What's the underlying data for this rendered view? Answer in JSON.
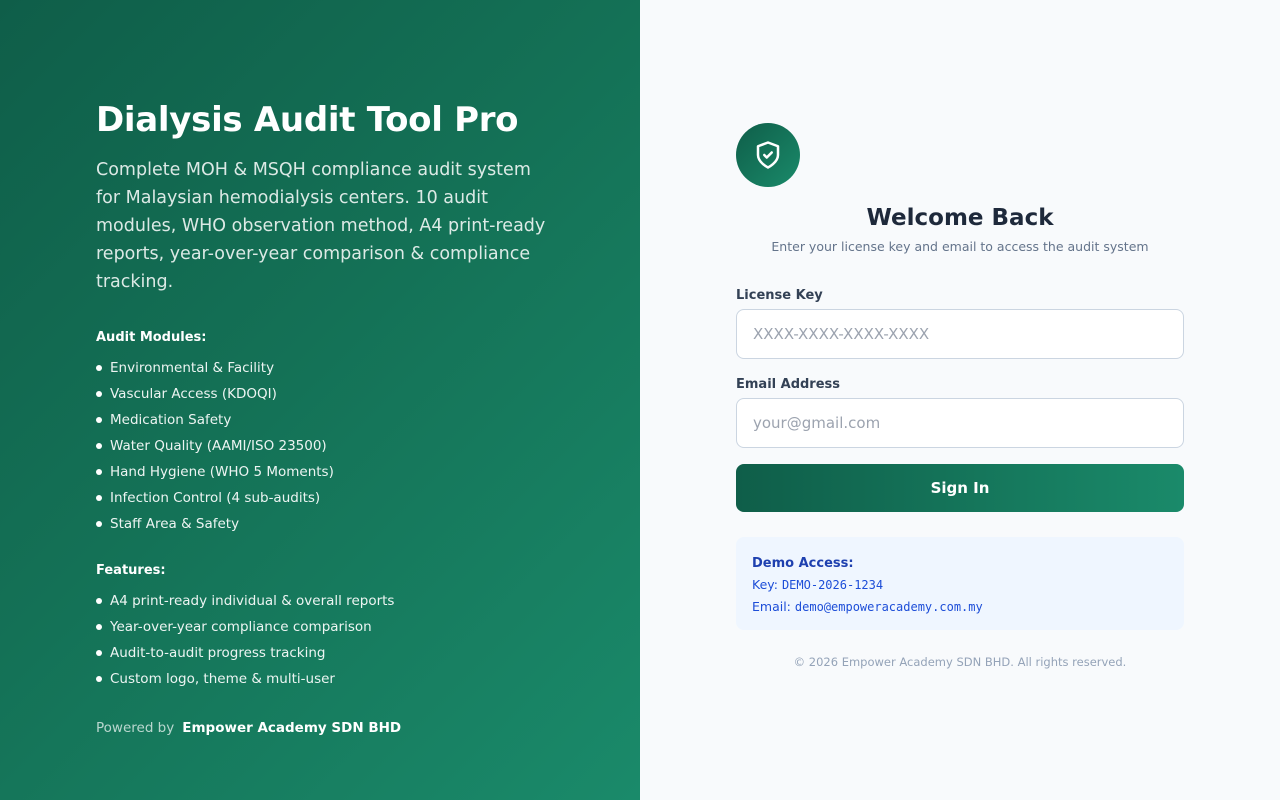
{
  "brand": {
    "title": "Dialysis Audit Tool Pro",
    "description": "Complete MOH & MSQH compliance audit system for Malaysian hemodialysis centers. 10 audit modules, WHO observation method, A4 print-ready reports, year-over-year comparison & compliance tracking."
  },
  "modules": {
    "title": "Audit Modules:",
    "items": [
      "Environmental & Facility",
      "Vascular Access (KDOQI)",
      "Medication Safety",
      "Water Quality (AAMI/ISO 23500)",
      "Hand Hygiene (WHO 5 Moments)",
      "Infection Control (4 sub-audits)",
      "Staff Area & Safety"
    ]
  },
  "features": {
    "title": "Features:",
    "items": [
      "A4 print-ready individual & overall reports",
      "Year-over-year compliance comparison",
      "Audit-to-audit progress tracking",
      "Custom logo, theme & multi-user"
    ]
  },
  "powered_by": {
    "label": "Powered by",
    "company": "Empower Academy SDN BHD"
  },
  "login": {
    "icon": "shield-check-icon",
    "title": "Welcome Back",
    "subtitle": "Enter your license key and email to access the audit system",
    "license_label": "License Key",
    "license_placeholder": "XXXX-XXXX-XXXX-XXXX",
    "license_value": "",
    "email_label": "Email Address",
    "email_placeholder": "your@gmail.com",
    "email_value": "",
    "submit_label": "Sign In"
  },
  "demo": {
    "title": "Demo Access:",
    "key_label": "Key:",
    "key_value": "DEMO-2026-1234",
    "email_label": "Email:",
    "email_value": "demo@empoweracademy.com.my"
  },
  "footer": {
    "copyright": "© 2026 Empower Academy SDN BHD. All rights reserved."
  },
  "colors": {
    "brand_dark": "#0f5e49",
    "brand_light": "#1a8a6a",
    "demo_bg": "#eff6ff",
    "demo_text": "#1d4ed8"
  }
}
